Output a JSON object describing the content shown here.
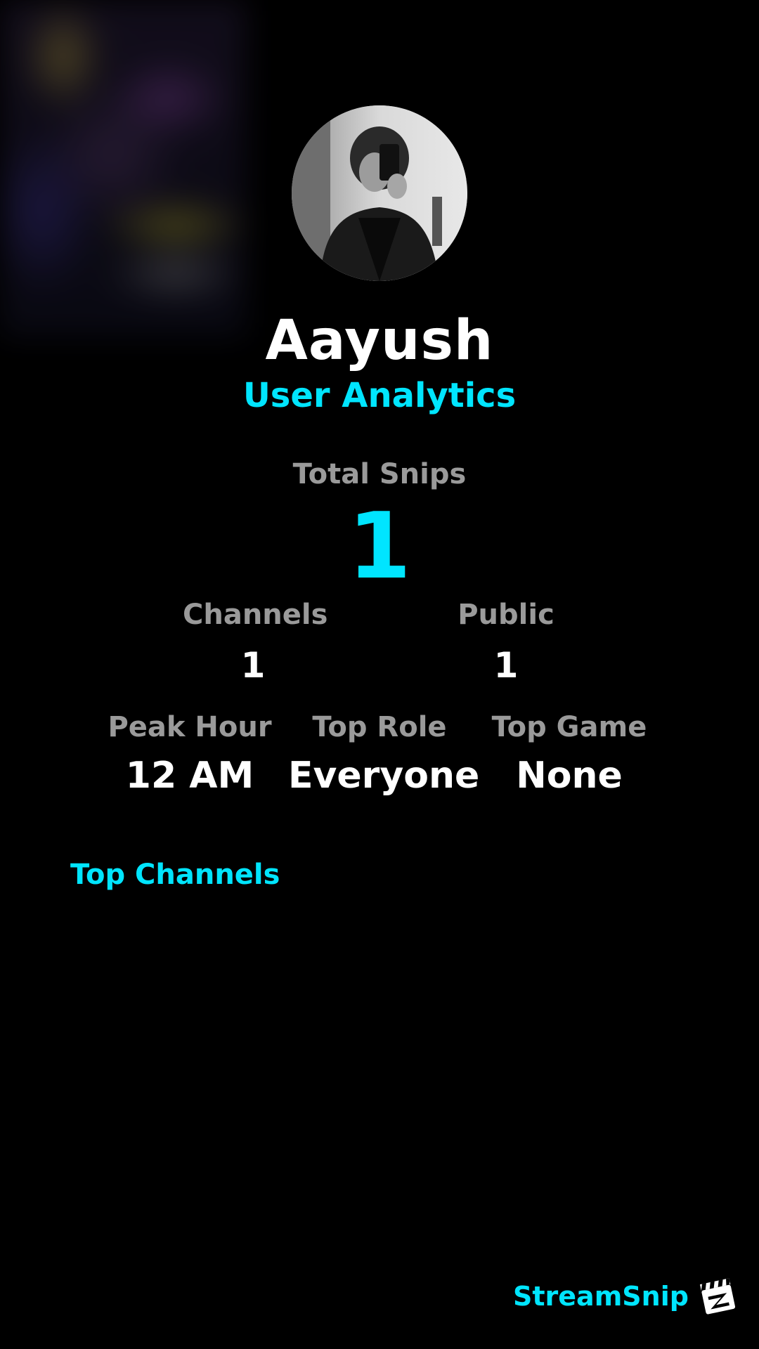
{
  "profile": {
    "name": "Aayush",
    "subtitle": "User Analytics"
  },
  "stats": {
    "total_label": "Total Snips",
    "total_value": "1",
    "channels_label": "Channels",
    "channels_value": "1",
    "public_label": "Public",
    "public_value": "1",
    "peak_hour_label": "Peak Hour",
    "peak_hour_value": "12 AM",
    "top_role_label": "Top Role",
    "top_role_value": "Everyone",
    "top_game_label": "Top Game",
    "top_game_value": "None"
  },
  "sections": {
    "top_channels_title": "Top Channels"
  },
  "brand": {
    "name": "StreamSnip",
    "logo_icon": "clapperboard-logo-icon"
  },
  "colors": {
    "accent": "#00e5ff",
    "background": "#000000",
    "label": "#9a9a9a",
    "text": "#ffffff"
  }
}
